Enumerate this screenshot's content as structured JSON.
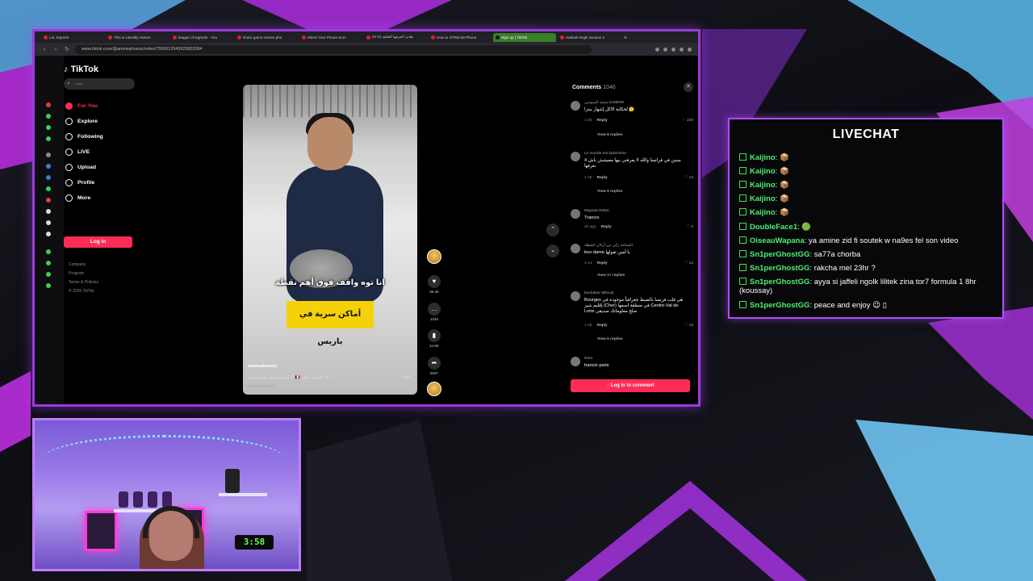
{
  "browser": {
    "tabs": [
      {
        "label": "LoL Esports",
        "active": false
      },
      {
        "label": "This is Literally Asmon",
        "active": false
      },
      {
        "label": "league of legends - You",
        "active": false
      },
      {
        "label": "share game screen pho",
        "active": false
      },
      {
        "label": "Mirror Your Phone Scre",
        "active": false
      },
      {
        "label": "Or هاذي الحرقها الحلقة 01",
        "active": false
      },
      {
        "label": "How to STREAM Phone",
        "active": false
      },
      {
        "label": "Sign up | TikTok",
        "active": true
      },
      {
        "label": "Sahbek Rajel Season 2",
        "active": false
      }
    ],
    "url": "www.tiktok.com/@aminsahraoui/video/7590012945925803284"
  },
  "tiktok": {
    "logo": "TikTok",
    "search_placeholder": "بحث",
    "nav": [
      {
        "label": "For You",
        "active": true
      },
      {
        "label": "Explore",
        "active": false
      },
      {
        "label": "Following",
        "active": false
      },
      {
        "label": "LIVE",
        "active": false
      },
      {
        "label": "Upload",
        "active": false
      },
      {
        "label": "Profile",
        "active": false
      },
      {
        "label": "More",
        "active": false
      }
    ],
    "login_label": "Log in",
    "footer": [
      "Company",
      "Program",
      "Terms & Policies",
      "© 2026 TikTok"
    ]
  },
  "video": {
    "subtitle_top": "انا توه واقف فوق أهم نقطة",
    "subtitle_box": "أماكن سرية في باريس",
    "author": "aminsahraoui",
    "caption": "أماكن سرية هي قلب باريس 🇫🇷 هل كنت تعلم 😮 ...",
    "more_label": "more",
    "translate_label": "See translation"
  },
  "actions": {
    "likes": "36.4K",
    "comments": "1046",
    "saves": "11.8K",
    "shares": "6837"
  },
  "comments": {
    "title": "Comments",
    "count": "1046",
    "login_label": "Log in to comment",
    "items": [
      {
        "user": "سمية السوسي ss39000",
        "text": "لحكاية الاكل إشهار بيتزا 🤔",
        "time": "1-25",
        "reply": "Reply",
        "likes": "220",
        "view": "View 6 replies"
      },
      {
        "user": "Le monde est éphémère",
        "text": "4 سنين في فرانسا والله لا يعرفني بيها معيشش باش نعرفها",
        "time": "1-25",
        "reply": "Reply",
        "likes": "12",
        "view": "View 5 replies"
      },
      {
        "user": "Maysaa Rebai",
        "text": "Trancio",
        "time": "3h ago",
        "reply": "Reply",
        "likes": "0",
        "view": ""
      },
      {
        "user": "الحمامة زكي من أركان الشطة",
        "text": "leur dame يا أمين تقولها",
        "time": "1-24",
        "reply": "Reply",
        "likes": "12",
        "view": "View 17 replies"
      },
      {
        "user": "boubaker Miloudi",
        "text": "Bourges هي قلب فرنسا بالضبط جغرافياً موجودة في إقليم شير (Cher) في منطقة اسمها Centre-Val de Loire صلح معلوماتك صديقي",
        "time": "1-25",
        "reply": "Reply",
        "likes": "18",
        "view": "View 5 replies"
      },
      {
        "user": "Nora",
        "text": "trancio paris",
        "time": "",
        "reply": "",
        "likes": "",
        "view": ""
      }
    ]
  },
  "livechat": {
    "title": "LIVECHAT",
    "messages": [
      {
        "nick": "Kaijino",
        "text": "📦"
      },
      {
        "nick": "Kaijino",
        "text": "📦"
      },
      {
        "nick": "Kaijino",
        "text": "📦"
      },
      {
        "nick": "Kaijino",
        "text": "📦"
      },
      {
        "nick": "Kaijino",
        "text": "📦"
      },
      {
        "nick": "DoubleFace1",
        "text": "🟢"
      },
      {
        "nick": "OiseauWapana",
        "text": "ya amine zid fi soutek w na9es fel son video"
      },
      {
        "nick": "Sn1perGhostGG",
        "text": "sa77a chorba"
      },
      {
        "nick": "Sn1perGhostGG",
        "text": "rakcha mel 23hr ?"
      },
      {
        "nick": "Sn1perGhostGG",
        "text": "ayya si jaffeli ngolk lilitek zina tor7 formula 1 8hr (koussay)"
      },
      {
        "nick": "Sn1perGhostGG",
        "text": "peace and enjoy 😉 ▯"
      }
    ]
  },
  "webcam": {
    "clock": "3:58"
  },
  "colors": {
    "accent_purple": "#9b3bdc",
    "tiktok_red": "#fe2c55",
    "chat_green": "#4cf070"
  }
}
